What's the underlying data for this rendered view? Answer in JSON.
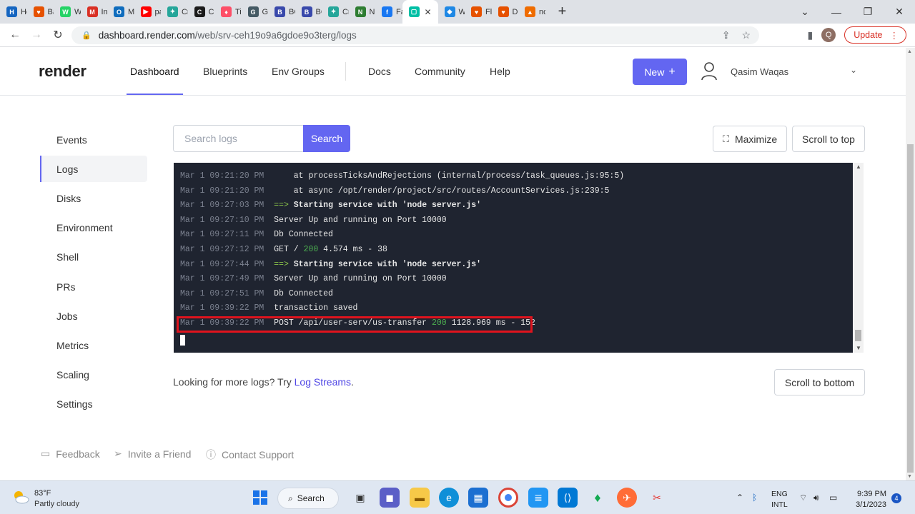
{
  "browser": {
    "tabs": [
      {
        "label": "Ho",
        "color": "#1565c0",
        "glyph": "H"
      },
      {
        "label": "Ba",
        "color": "#e65100",
        "glyph": "♥"
      },
      {
        "label": "Wh",
        "color": "#25d366",
        "glyph": "W"
      },
      {
        "label": "Inb",
        "color": "#d93025",
        "glyph": "M"
      },
      {
        "label": "Ma",
        "color": "#0f6cbd",
        "glyph": "O"
      },
      {
        "label": "pa",
        "color": "#ff0000",
        "glyph": "▶"
      },
      {
        "label": "Cre",
        "color": "#26a69a",
        "glyph": "✦"
      },
      {
        "label": "Cry",
        "color": "#1b1b1b",
        "glyph": "C"
      },
      {
        "label": "Tin",
        "color": "#fd5068",
        "glyph": "♦"
      },
      {
        "label": "Gr",
        "color": "#455a64",
        "glyph": "G"
      },
      {
        "label": "BC",
        "color": "#3949ab",
        "glyph": "B"
      },
      {
        "label": "BC",
        "color": "#3949ab",
        "glyph": "B"
      },
      {
        "label": "Cre",
        "color": "#26a69a",
        "glyph": "✦"
      },
      {
        "label": "Na",
        "color": "#2e7d32",
        "glyph": "N"
      },
      {
        "label": "Fac",
        "color": "#1877f2",
        "glyph": "f"
      },
      {
        "label": "",
        "color": "#00bfa5",
        "glyph": "▢",
        "active": true
      },
      {
        "label": "Wa",
        "color": "#1e88e5",
        "glyph": "◆"
      },
      {
        "label": "Flu",
        "color": "#e65100",
        "glyph": "♥"
      },
      {
        "label": "Da",
        "color": "#e65100",
        "glyph": "♥"
      },
      {
        "label": "no",
        "color": "#ef6c00",
        "glyph": "▲"
      }
    ],
    "url_domain": "dashboard.render.com",
    "url_path": "/web/srv-ceh19o9a6gdoe9o3terg/logs",
    "profile_initial": "Q",
    "update_label": "Update"
  },
  "header": {
    "logo": "render",
    "nav": [
      "Dashboard",
      "Blueprints",
      "Env Groups",
      "Docs",
      "Community",
      "Help"
    ],
    "new_label": "New",
    "user_name": "Qasim Waqas"
  },
  "sidebar": {
    "items": [
      "Events",
      "Logs",
      "Disks",
      "Environment",
      "Shell",
      "PRs",
      "Jobs",
      "Metrics",
      "Scaling",
      "Settings"
    ],
    "active": "Logs"
  },
  "search": {
    "placeholder": "Search logs",
    "button": "Search"
  },
  "actions": {
    "maximize": "Maximize",
    "scroll_top": "Scroll to top",
    "scroll_bottom": "Scroll to bottom"
  },
  "logs": [
    {
      "ts": "Mar 1 09:21:20 PM",
      "msg": "    at processTicksAndRejections (internal/process/task_queues.js:95:5)"
    },
    {
      "ts": "Mar 1 09:21:20 PM",
      "msg": "    at async /opt/render/project/src/routes/AccountServices.js:239:5"
    },
    {
      "ts": "Mar 1 09:27:03 PM",
      "arrow": "==>",
      "msg": " Starting service with 'node server.js'"
    },
    {
      "ts": "Mar 1 09:27:10 PM",
      "msg": "Server Up and running on Port 10000"
    },
    {
      "ts": "Mar 1 09:27:11 PM",
      "msg": "Db Connected"
    },
    {
      "ts": "Mar 1 09:27:12 PM",
      "msg": "GET / ",
      "status": "200",
      "tail": " 4.574 ms - 38"
    },
    {
      "ts": "Mar 1 09:27:44 PM",
      "arrow": "==>",
      "msg": " Starting service with 'node server.js'"
    },
    {
      "ts": "Mar 1 09:27:49 PM",
      "msg": "Server Up and running on Port 10000"
    },
    {
      "ts": "Mar 1 09:27:51 PM",
      "msg": "Db Connected"
    },
    {
      "ts": "Mar 1 09:39:22 PM",
      "msg": "transaction saved"
    },
    {
      "ts": "Mar 1 09:39:22 PM",
      "msg": "POST /api/user-serv/us-transfer ",
      "status": "200",
      "tail": " 1128.969 ms - 152",
      "highlight": true
    }
  ],
  "more_logs": {
    "prefix": "Looking for more logs? Try ",
    "link": "Log Streams",
    "suffix": "."
  },
  "footer": {
    "feedback": "Feedback",
    "invite": "Invite a Friend",
    "support": "Contact Support"
  },
  "taskbar": {
    "temp": "83°F",
    "weather": "Partly cloudy",
    "search": "Search",
    "lang_top": "ENG",
    "lang_bottom": "INTL",
    "time": "9:39 PM",
    "date": "3/1/2023",
    "notifications": "4"
  },
  "colors": {
    "accent": "#6366f1",
    "log_bg": "#1f2430",
    "status_ok": "#4caf50",
    "highlight": "#e0131d"
  }
}
